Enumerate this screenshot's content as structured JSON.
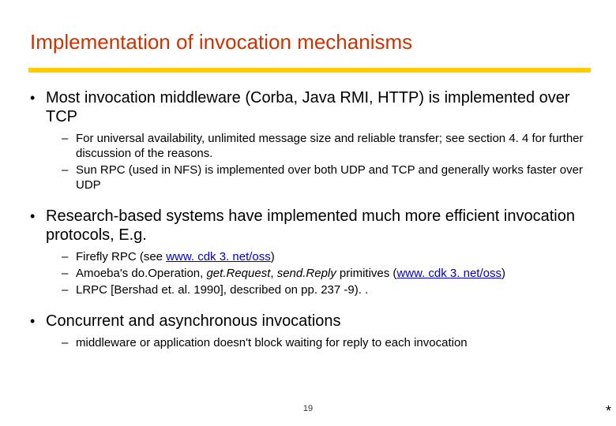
{
  "title": "Implementation of invocation mechanisms",
  "bullets": {
    "b1": {
      "text": "Most invocation middleware (Corba, Java RMI, HTTP) is implemented over TCP",
      "subs": {
        "s1": "For universal availability, unlimited message size and reliable transfer; see section 4. 4 for further discussion of the reasons.",
        "s2": "Sun RPC (used in NFS) is implemented over both UDP and TCP and generally works faster over UDP"
      }
    },
    "b2": {
      "text": "Research-based systems have implemented much more efficient invocation protocols, E.g.",
      "subs": {
        "s1a": "Firefly RPC (see ",
        "s1link": "www. cdk 3. net/oss",
        "s1b": ")",
        "s2a": "Amoeba's do.Operation, ",
        "s2i1": "get.Request",
        "s2mid": ", ",
        "s2i2": "send.Reply",
        "s2b": " primitives (",
        "s2link": "www. cdk 3. net/oss",
        "s2c": ")",
        "s3": "LRPC [Bershad et. al. 1990], described on pp. 237 -9). ."
      }
    },
    "b3": {
      "text": "Concurrent and asynchronous invocations",
      "subs": {
        "s1": "middleware or application doesn't block waiting for reply to each invocation"
      }
    }
  },
  "pagenum": "19",
  "asterisk": "*"
}
